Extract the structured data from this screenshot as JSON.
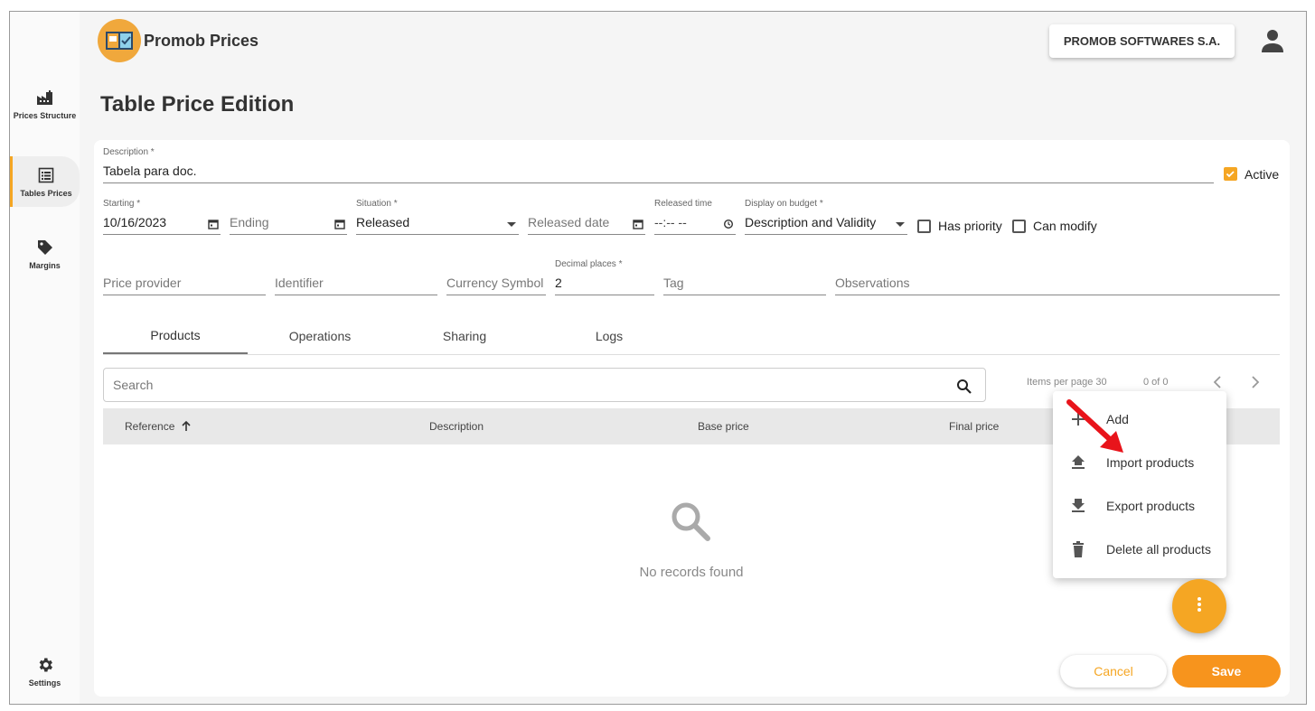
{
  "app": {
    "title": "Promob Prices",
    "company": "PROMOB SOFTWARES S.A."
  },
  "sidebar": {
    "items": [
      {
        "label": "Prices Structure",
        "icon": "factory-icon"
      },
      {
        "label": "Tables Prices",
        "icon": "list-icon",
        "active": true
      },
      {
        "label": "Margins",
        "icon": "tag-icon"
      },
      {
        "label": "Settings",
        "icon": "gear-icon"
      }
    ]
  },
  "page": {
    "title": "Table Price Edition"
  },
  "form": {
    "description": {
      "label": "Description *",
      "value": "Tabela para doc."
    },
    "active": {
      "label": "Active",
      "checked": true
    },
    "starting": {
      "label": "Starting *",
      "value": "10/16/2023"
    },
    "ending": {
      "placeholder": "Ending"
    },
    "situation": {
      "label": "Situation *",
      "value": "Released"
    },
    "released_date": {
      "placeholder": "Released date"
    },
    "released_time": {
      "label": "Released time",
      "value": "--:-- --"
    },
    "display_on_budget": {
      "label": "Display on budget *",
      "value": "Description and Validity"
    },
    "has_priority": {
      "label": "Has priority",
      "checked": false
    },
    "can_modify": {
      "label": "Can modify",
      "checked": false
    },
    "price_provider": {
      "placeholder": "Price provider"
    },
    "identifier": {
      "placeholder": "Identifier"
    },
    "currency_symbol": {
      "placeholder": "Currency Symbol"
    },
    "decimal_places": {
      "label": "Decimal places *",
      "value": "2"
    },
    "tag": {
      "placeholder": "Tag"
    },
    "observations": {
      "placeholder": "Observations"
    }
  },
  "tabs": [
    {
      "label": "Products",
      "active": true
    },
    {
      "label": "Operations"
    },
    {
      "label": "Sharing"
    },
    {
      "label": "Logs"
    }
  ],
  "search": {
    "placeholder": "Search"
  },
  "pager": {
    "items_per_page": "Items per page 30",
    "range": "0 of 0"
  },
  "table": {
    "columns": [
      "Reference",
      "Description",
      "Base price",
      "Final price"
    ]
  },
  "empty": {
    "text": "No records found"
  },
  "menu": {
    "items": [
      {
        "label": "Add",
        "icon": "plus-icon"
      },
      {
        "label": "Import products",
        "icon": "upload-icon"
      },
      {
        "label": "Export products",
        "icon": "download-icon"
      },
      {
        "label": "Delete all products",
        "icon": "trash-icon"
      }
    ]
  },
  "actions": {
    "cancel": "Cancel",
    "save": "Save"
  },
  "colors": {
    "accent": "#f5a623",
    "save": "#f7941d",
    "arrow": "#e8141b"
  }
}
